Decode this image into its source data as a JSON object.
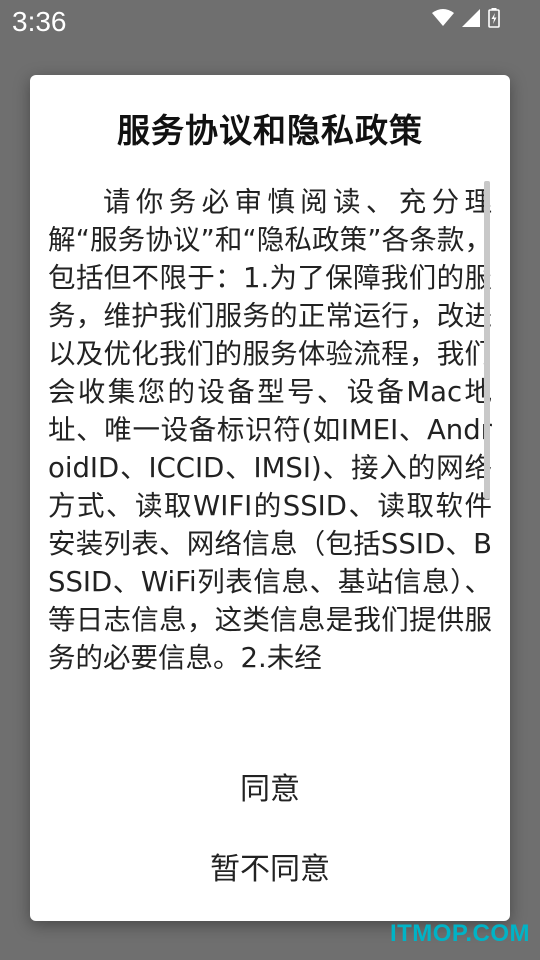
{
  "status_bar": {
    "time": "3:36",
    "icons": [
      "wifi-icon",
      "signal-icon",
      "battery-icon"
    ]
  },
  "dialog": {
    "title": "服务协议和隐私政策",
    "body": "请你务必审慎阅读、充分理解“服务协议”和“隐私政策”各条款，包括但不限于：1.为了保障我们的服务，维护我们服务的正常运行，改进以及优化我们的服务体验流程，我们会收集您的设备型号、设备Mac地址、唯一设备标识符(如IMEI、AndroidID、ICCID、IMSI)、接入的网络方式、读取WIFI的SSID、读取软件安装列表、网络信息（包括SSID、BSSID、WiFi列表信息、基站信息）、等日志信息，这类信息是我们提供服务的必要信息。2.未经",
    "agree_label": "同意",
    "disagree_label": "暂不同意"
  },
  "watermark": "ITMOP.COM",
  "colors": {
    "scrim": "#6f6f6f",
    "dialog_bg": "#ffffff",
    "watermark": "#00b3c6"
  }
}
